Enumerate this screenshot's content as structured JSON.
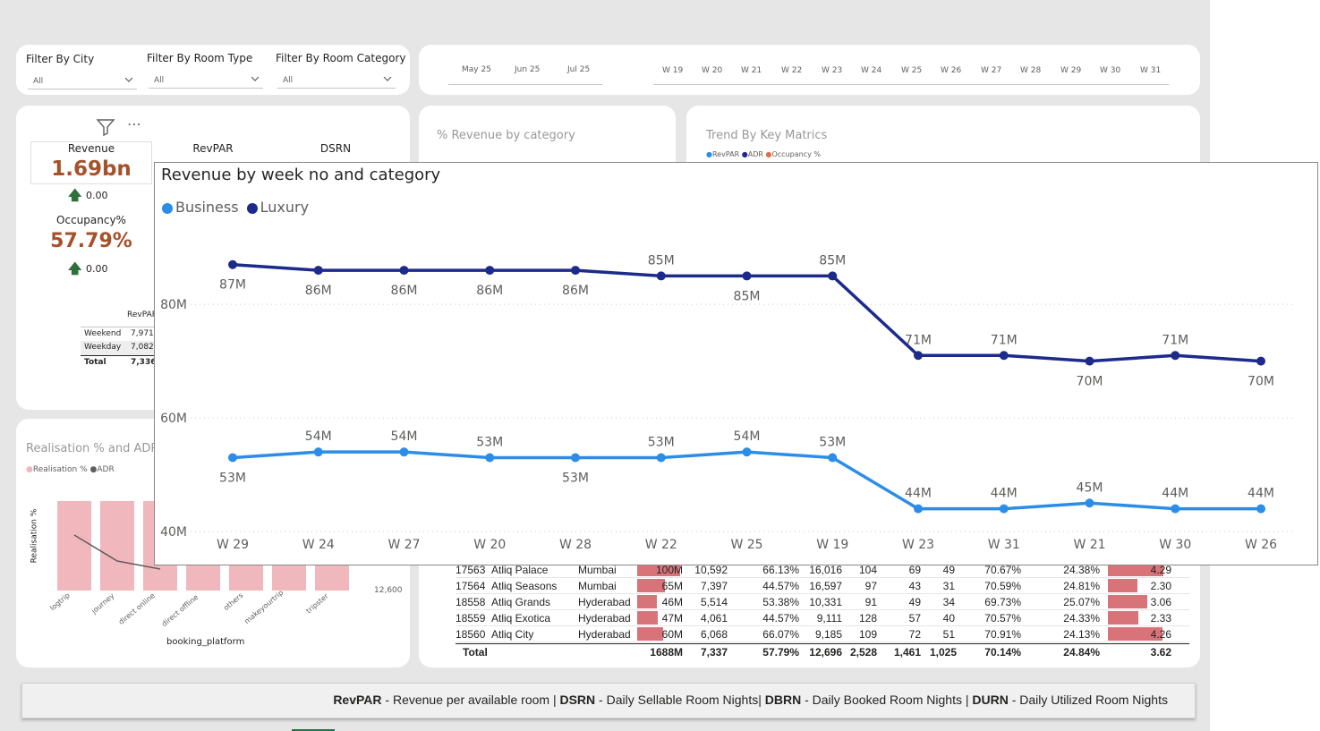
{
  "filters": [
    {
      "label": "Filter By City",
      "value": "All"
    },
    {
      "label": "Filter By Room Type",
      "value": "All"
    },
    {
      "label": "Filter By Room Category",
      "value": "All"
    }
  ],
  "timeline": {
    "months": [
      "May 25",
      "Jun 25",
      "Jul 25"
    ],
    "weeks": [
      "W 19",
      "W 20",
      "W 21",
      "W 22",
      "W 23",
      "W 24",
      "W 25",
      "W 26",
      "W 27",
      "W 28",
      "W 29",
      "W 30",
      "W 31"
    ]
  },
  "kpis": {
    "revenue_label": "Revenue",
    "revenue_value": "1.69bn",
    "revenue_delta": "0.00",
    "revpar_label": "RevPAR",
    "dsrn_label": "DSRN",
    "occupancy_label": "Occupancy%",
    "occupancy_value": "57.79%",
    "occupancy_delta": "0.00",
    "mini_header": "RevPAR",
    "mini_rows": [
      {
        "label": "Weekend",
        "value": "7,971."
      },
      {
        "label": "Weekday",
        "value": "7,082"
      },
      {
        "label": "Total",
        "value": "7,336."
      }
    ]
  },
  "cards": {
    "revenue_by_category": "% Revenue by category",
    "trend_title": "Trend By Key Matrics",
    "trend_legend": [
      "RevPAR",
      "ADR",
      "Occupancy %"
    ],
    "realisation_title": "Realisation % and ADR",
    "realisation_legend": [
      "Realisation %",
      "ADR"
    ],
    "realisation_ylabel": "Realisation %",
    "realisation_xlabel": "booking_platform",
    "platforms": [
      "logtrip",
      "journey",
      "direct online",
      "direct offline",
      "others",
      "makeyourtrip",
      "tripster"
    ],
    "adr_tick": "12,600",
    "adr_tick_top": "12,..."
  },
  "table": {
    "rows": [
      {
        "id": "17563",
        "name": "Atliq Palace",
        "city": "Mumbai",
        "revenue": "100M",
        "revpar": "10,592",
        "occ": "66.13%",
        "adr": "16,016",
        "dsrn": "104",
        "dbrn": "69",
        "durn": "49",
        "real": "70.67%",
        "cancel": "24.38%",
        "rating": "4.29"
      },
      {
        "id": "17564",
        "name": "Atliq Seasons",
        "city": "Mumbai",
        "revenue": "65M",
        "revpar": "7,397",
        "occ": "44.57%",
        "adr": "16,597",
        "dsrn": "97",
        "dbrn": "43",
        "durn": "31",
        "real": "70.59%",
        "cancel": "24.81%",
        "rating": "2.30"
      },
      {
        "id": "18558",
        "name": "Atliq Grands",
        "city": "Hyderabad",
        "revenue": "46M",
        "revpar": "5,514",
        "occ": "53.38%",
        "adr": "10,331",
        "dsrn": "91",
        "dbrn": "49",
        "durn": "34",
        "real": "69.73%",
        "cancel": "25.07%",
        "rating": "3.06"
      },
      {
        "id": "18559",
        "name": "Atliq Exotica",
        "city": "Hyderabad",
        "revenue": "47M",
        "revpar": "4,061",
        "occ": "44.57%",
        "adr": "9,111",
        "dsrn": "128",
        "dbrn": "57",
        "durn": "40",
        "real": "70.57%",
        "cancel": "24.33%",
        "rating": "2.33"
      },
      {
        "id": "18560",
        "name": "Atliq City",
        "city": "Hyderabad",
        "revenue": "60M",
        "revpar": "6,068",
        "occ": "66.07%",
        "adr": "9,185",
        "dsrn": "109",
        "dbrn": "72",
        "durn": "51",
        "real": "70.91%",
        "cancel": "24.13%",
        "rating": "4.26"
      }
    ],
    "total": {
      "label": "Total",
      "revenue": "1688M",
      "revpar": "7,337",
      "occ": "57.79%",
      "adr": "12,696",
      "dsrn": "2,528",
      "dbrn": "1,461",
      "durn": "1,025",
      "real": "70.14%",
      "cancel": "24.84%",
      "rating": "3.62"
    }
  },
  "footer": {
    "t1": "RevPAR",
    "d1": " - Revenue per available room | ",
    "t2": "DSRN",
    "d2": " - Daily Sellable Room Nights| ",
    "t3": "DBRN",
    "d3": " - Daily Booked Room Nights | ",
    "t4": "DURN",
    "d4": " - Daily Utilized Room Nights"
  },
  "colors": {
    "business": "#2b8de8",
    "luxury": "#1c2a8c",
    "kpi": "#a4522b",
    "bar_red": "#d9737a"
  },
  "chart_data": {
    "type": "line",
    "title": "Revenue by week no and category",
    "categories": [
      "W 29",
      "W 24",
      "W 27",
      "W 20",
      "W 28",
      "W 22",
      "W 25",
      "W 19",
      "W 23",
      "W 31",
      "W 21",
      "W 30",
      "W 26"
    ],
    "series": [
      {
        "name": "Business",
        "values": [
          53,
          54,
          54,
          53,
          53,
          53,
          54,
          53,
          44,
          44,
          45,
          44,
          44
        ],
        "labels": [
          "53M",
          "54M",
          "54M",
          "53M",
          "53M",
          "53M",
          "54M",
          "53M",
          "44M",
          "44M",
          "45M",
          "44M",
          "44M"
        ]
      },
      {
        "name": "Luxury",
        "values": [
          87,
          86,
          86,
          86,
          86,
          85,
          85,
          85,
          71,
          71,
          70,
          71,
          70
        ],
        "labels": [
          "87M",
          "86M",
          "86M",
          "86M",
          "86M",
          "85M",
          "85M",
          "85M",
          "71M",
          "71M",
          "70M",
          "71M",
          "70M"
        ]
      }
    ],
    "yticks": [
      "40M",
      "60M",
      "80M"
    ],
    "ylim": [
      40,
      92
    ],
    "grid": true,
    "legend_position": "top-left"
  }
}
